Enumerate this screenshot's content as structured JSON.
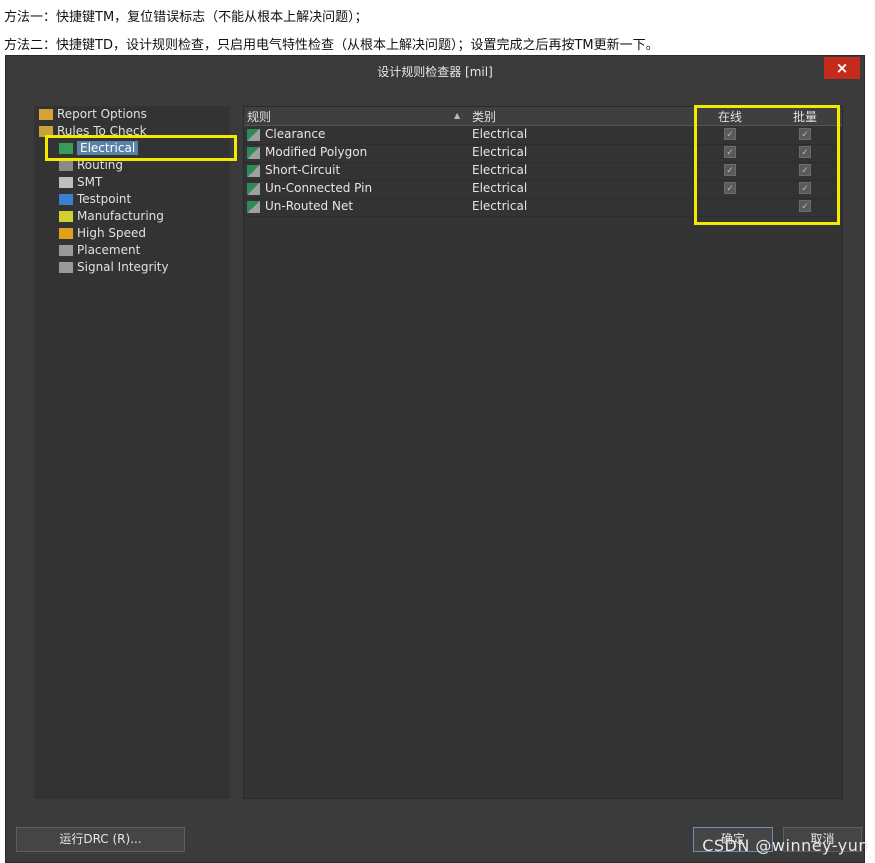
{
  "notes": {
    "line1": "方法一：快捷键TM，复位错误标志（不能从根本上解决问题）；",
    "line2": "方法二：快捷键TD，设计规则检查，只启用电气特性检查（从根本上解决问题）；设置完成之后再按TM更新一下。"
  },
  "window": {
    "title": "设计规则检查器 [mil]",
    "close": "×"
  },
  "tree": [
    {
      "label": "Report Options",
      "icon": "report-options-icon"
    },
    {
      "label": "Rules To Check",
      "icon": "rules-to-check-icon"
    },
    {
      "label": "Electrical",
      "icon": "electrical-icon",
      "selected": true
    },
    {
      "label": "Routing",
      "icon": "routing-icon"
    },
    {
      "label": "SMT",
      "icon": "smt-icon"
    },
    {
      "label": "Testpoint",
      "icon": "testpoint-icon"
    },
    {
      "label": "Manufacturing",
      "icon": "manufacturing-icon"
    },
    {
      "label": "High Speed",
      "icon": "high-speed-icon"
    },
    {
      "label": "Placement",
      "icon": "placement-icon"
    },
    {
      "label": "Signal Integrity",
      "icon": "signal-integrity-icon"
    }
  ],
  "table": {
    "headers": {
      "rule": "规则",
      "category": "类别",
      "online": "在线",
      "batch": "批量"
    },
    "rows": [
      {
        "rule": "Clearance",
        "category": "Electrical",
        "online": true,
        "batch": true
      },
      {
        "rule": "Modified Polygon",
        "category": "Electrical",
        "online": true,
        "batch": true
      },
      {
        "rule": "Short-Circuit",
        "category": "Electrical",
        "online": true,
        "batch": true
      },
      {
        "rule": "Un-Connected Pin",
        "category": "Electrical",
        "online": true,
        "batch": true
      },
      {
        "rule": "Un-Routed Net",
        "category": "Electrical",
        "online": false,
        "batch": true
      }
    ]
  },
  "buttons": {
    "run_drc": "运行DRC (R)...",
    "ok": "确定",
    "cancel": "取消"
  },
  "watermark": "CSDN @winney-yun",
  "colors": {
    "highlight": "#f2ea00",
    "selected": "#5a81a8",
    "close": "#c42b1c"
  }
}
